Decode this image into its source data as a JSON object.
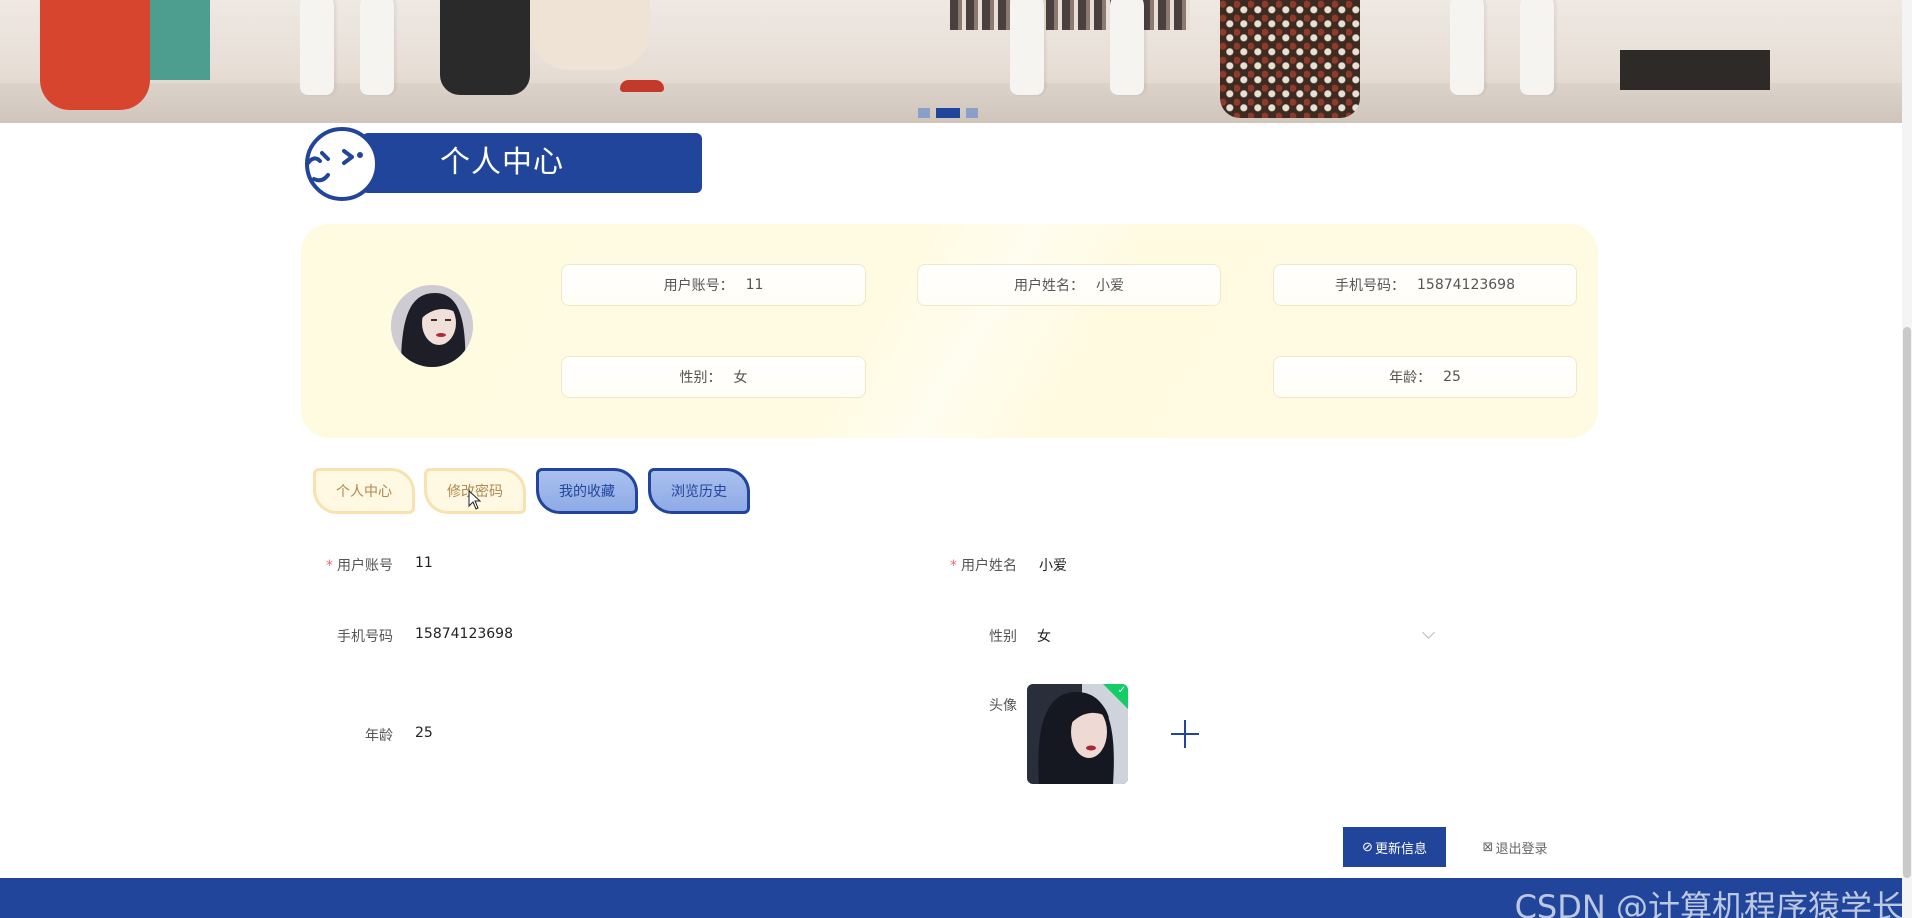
{
  "banner": {
    "slide_count": 3,
    "active_slide": 2
  },
  "title": {
    "text": "个人中心"
  },
  "info": {
    "account": {
      "label": "用户账号：",
      "value": "11"
    },
    "name": {
      "label": "用户姓名：",
      "value": "小爱"
    },
    "phone": {
      "label": "手机号码：",
      "value": "15874123698"
    },
    "gender": {
      "label": "性别：",
      "value": "女"
    },
    "age": {
      "label": "年龄：",
      "value": "25"
    }
  },
  "tabs": [
    {
      "label": "个人中心",
      "style": "light"
    },
    {
      "label": "修改密码",
      "style": "light"
    },
    {
      "label": "我的收藏",
      "style": "dark"
    },
    {
      "label": "浏览历史",
      "style": "dark"
    }
  ],
  "form": {
    "account": {
      "label": "用户账号",
      "value": "11",
      "required": true
    },
    "name": {
      "label": "用户姓名",
      "value": "小爱",
      "required": true
    },
    "phone": {
      "label": "手机号码",
      "value": "15874123698"
    },
    "gender": {
      "label": "性别",
      "value": "女"
    },
    "age": {
      "label": "年龄",
      "value": "25"
    },
    "avatar": {
      "label": "头像"
    }
  },
  "buttons": {
    "update": "更新信息",
    "logout": "退出登录"
  },
  "watermark": "CSDN @计算机程序猿学长",
  "colors": {
    "primary": "#21459a",
    "card_bg": "#fffbe3",
    "tab_light_bg": "#fff8e2",
    "success": "#13ce66",
    "required": "#f56c6c"
  }
}
